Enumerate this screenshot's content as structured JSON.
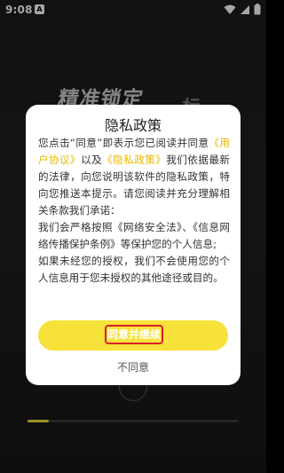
{
  "status_bar": {
    "time": "9:08",
    "notification_icon": "A"
  },
  "background": {
    "hero_text": "精准锁定",
    "hero_text_tail": "标",
    "progress": 0.1
  },
  "dialog": {
    "title": "隐私政策",
    "para1_a": "您点击“同意”即表示您已阅读并同意",
    "link_user_agreement": "《用户协议》",
    "para1_b": "以及",
    "link_privacy_policy": "《隐私政策》",
    "para1_c": "我们依据最新的法律，向您说明该软件的隐私政策，特向您推送本提示。请您阅读并充分理解相关条款我们承诺：",
    "para2": "我们会严格按照《网络安全法》、《信息网络传播保护条例》等保护您的个人信息;",
    "para3": "如果未经您的授权，我们不会使用您的个人信息用于您未授权的其他途径或目的。",
    "agree_button": "同意并继续",
    "disagree_button": "不同意"
  },
  "colors": {
    "accent_yellow": "#f7e23a",
    "link_color": "#e8b800",
    "highlight_border": "#d9202a"
  }
}
